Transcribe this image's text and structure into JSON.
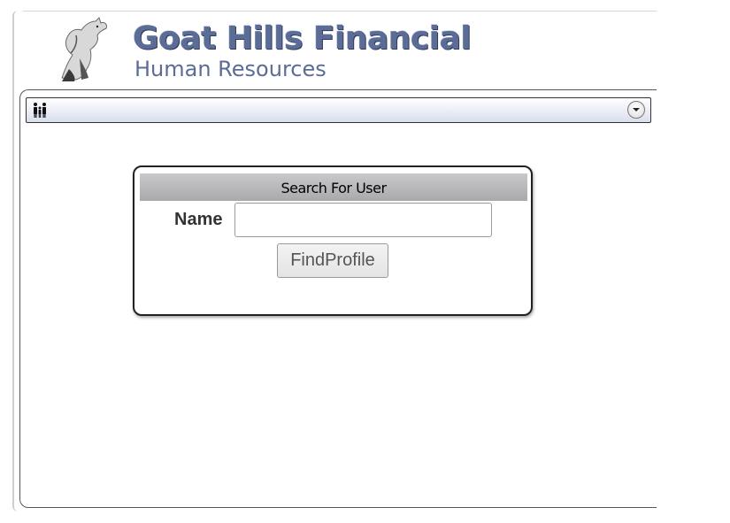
{
  "header": {
    "title": "Goat Hills Financial",
    "subtitle": "Human Resources",
    "logo_icon": "goat-logo-icon"
  },
  "navbar": {
    "icon": "people-icon",
    "dropdown_icon": "chevron-down-icon"
  },
  "search_panel": {
    "title": "Search For User",
    "name_label": "Name",
    "name_value": "",
    "button_label": "FindProfile"
  },
  "colors": {
    "brand": "#5b6c96",
    "panel_header": "#b5b5b8"
  }
}
